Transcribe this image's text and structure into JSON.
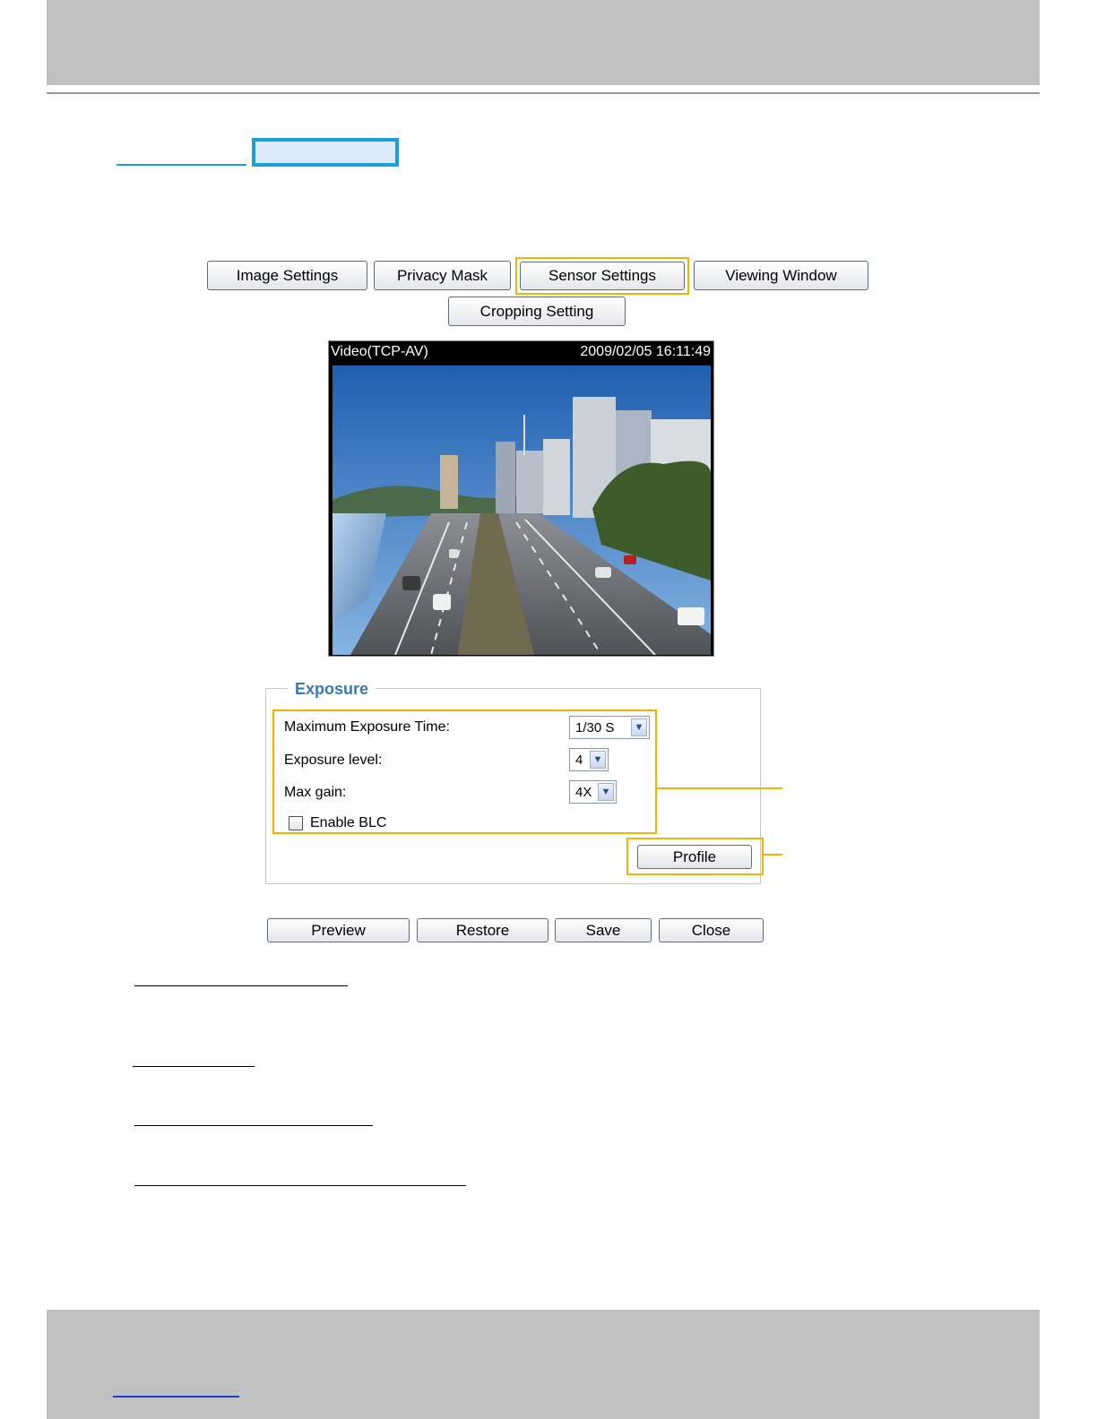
{
  "tabs": {
    "image_settings": "Image Settings",
    "privacy_mask": "Privacy Mask",
    "sensor_settings": "Sensor Settings",
    "viewing_window": "Viewing Window",
    "cropping_setting": "Cropping Setting"
  },
  "video": {
    "stream_label": "Video(TCP-AV)",
    "timestamp": "2009/02/05 16:11:49"
  },
  "exposure": {
    "legend": "Exposure",
    "max_exposure_label": "Maximum Exposure Time:",
    "max_exposure_value": "1/30 S",
    "exposure_level_label": "Exposure level:",
    "exposure_level_value": "4",
    "max_gain_label": "Max gain:",
    "max_gain_value": "4X",
    "blc_label": "Enable BLC",
    "blc_checked": false,
    "profile_button": "Profile"
  },
  "actions": {
    "preview": "Preview",
    "restore": "Restore",
    "save": "Save",
    "close": "Close"
  },
  "colors": {
    "header_bar": "#c0c0c0",
    "highlight": "#f0b400",
    "tab_highlight": "#1aa0dc",
    "legend_text": "#3a78b8"
  }
}
